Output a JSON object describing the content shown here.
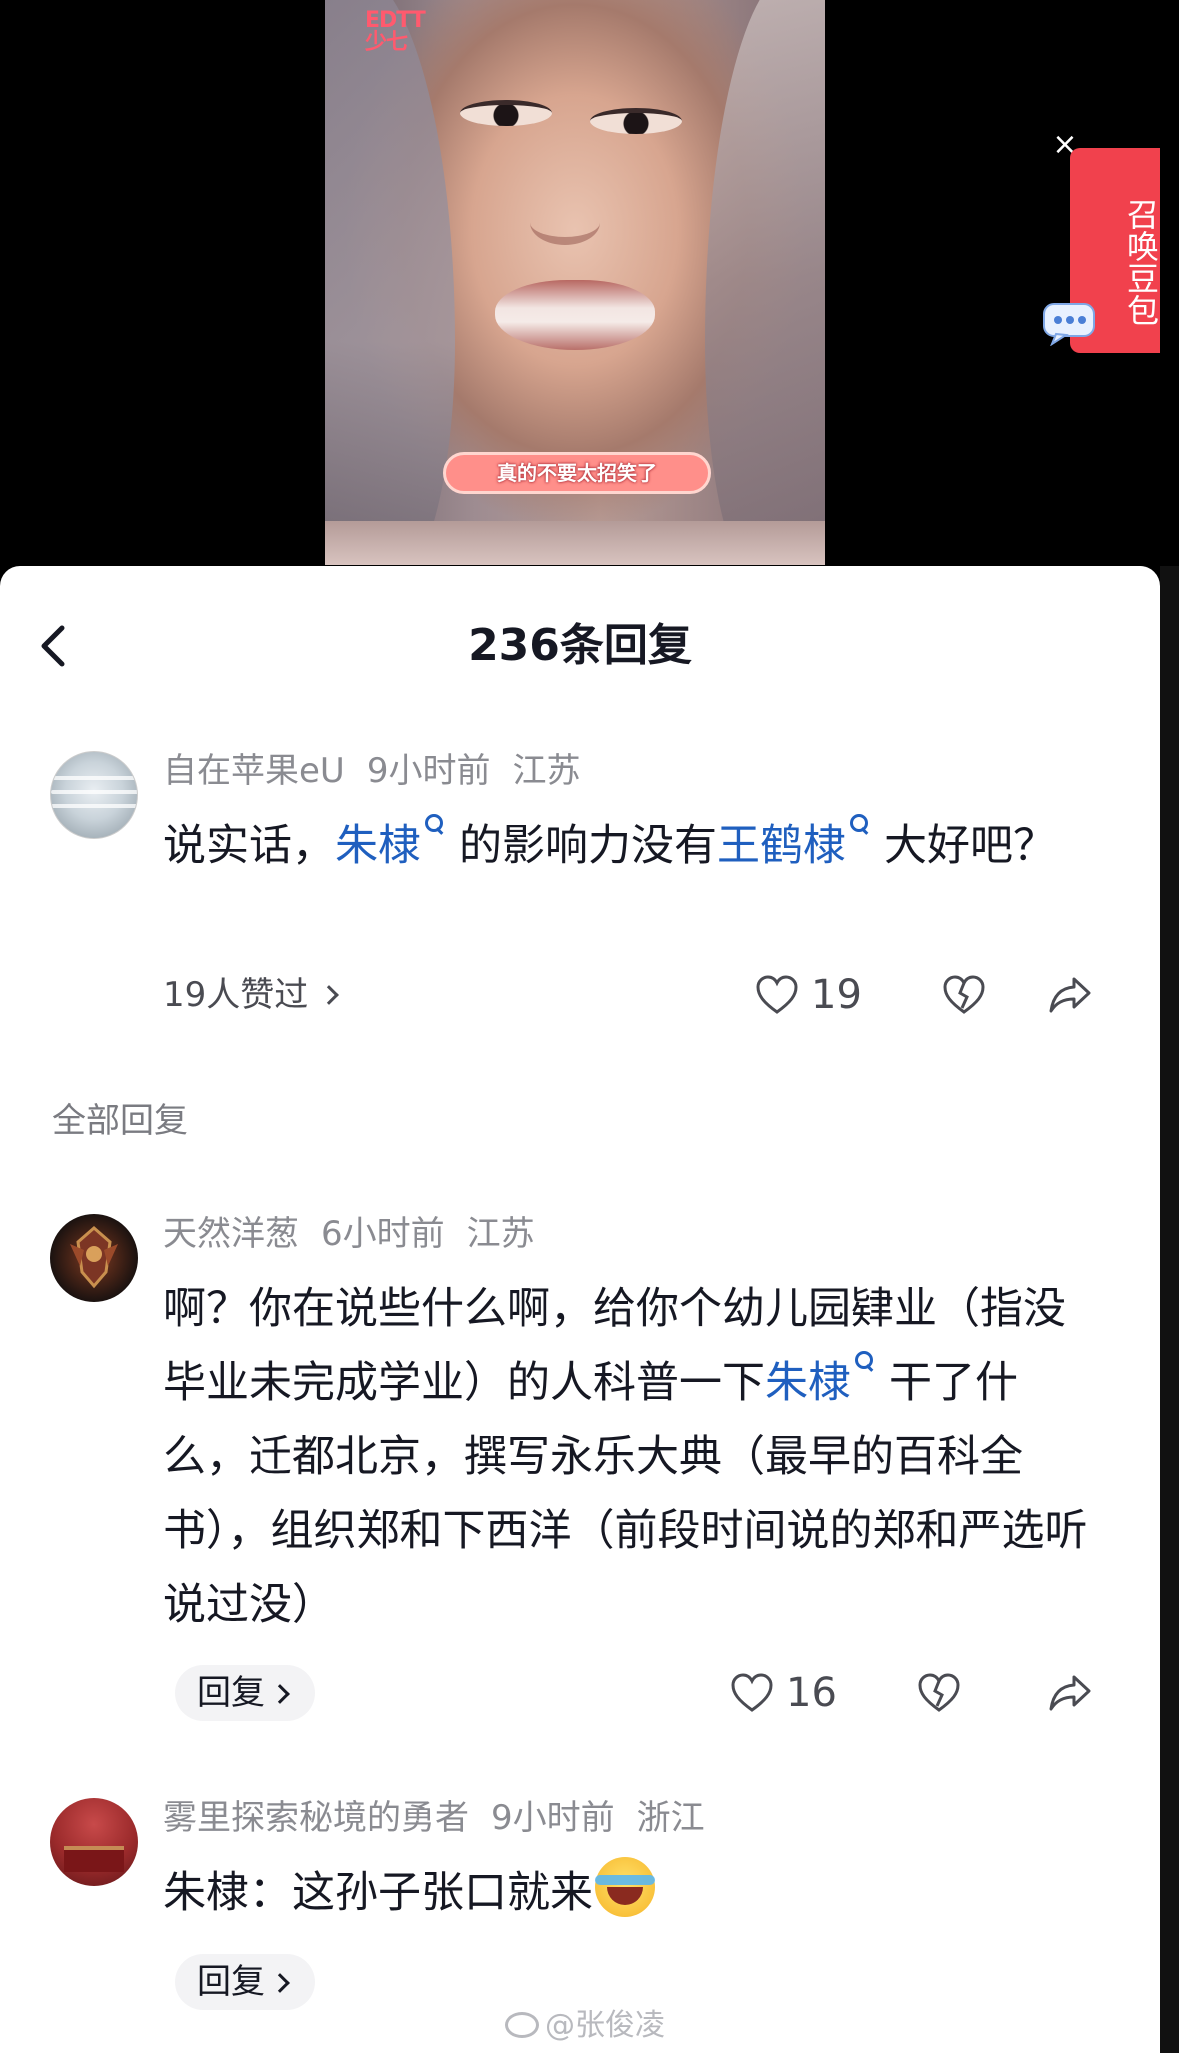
{
  "video": {
    "logo_text": "EDTT 少七",
    "caption": "真的不要太招笑了",
    "close_glyph": "×",
    "summon_label": "召唤豆包"
  },
  "sheet": {
    "title": "236条回复"
  },
  "top_comment": {
    "author": "自在苹果eU",
    "time": "9小时前",
    "location": "江苏",
    "content_parts": [
      "说实话，",
      "朱棣",
      "的影响力没有",
      "王鹤棣",
      "大好吧？"
    ],
    "likes_link": "19人赞过",
    "like_count": "19"
  },
  "replies_section_label": "全部回复",
  "replies": [
    {
      "author": "天然洋葱",
      "time": "6小时前",
      "location": "江苏",
      "content_parts": [
        "啊？你在说些什么啊，给你个幼儿园肄业（指没毕业未完成学业）的人科普一下",
        "朱棣",
        "干了什么，迁都北京，撰写永乐大典（最早的百科全书），组织郑和下西洋（前段时间说的郑和严选听说过没）"
      ],
      "reply_label": "回复",
      "like_count": "16"
    },
    {
      "author": "雾里探索秘境的勇者",
      "time": "9小时前",
      "location": "浙江",
      "content": "朱棣：这孙子张口就来",
      "reply_label": "回复"
    }
  ],
  "watermark": "@张俊凌",
  "icons": [
    "back-chevron-icon",
    "heart-icon",
    "dislike-heart-icon",
    "share-icon",
    "search-lens-icon",
    "chat-bubble-icon",
    "weibo-icon"
  ],
  "colors": {
    "link": "#1f5fbf",
    "summon_tab": "#f1414d",
    "caption_pill": "#ff8f8a"
  }
}
